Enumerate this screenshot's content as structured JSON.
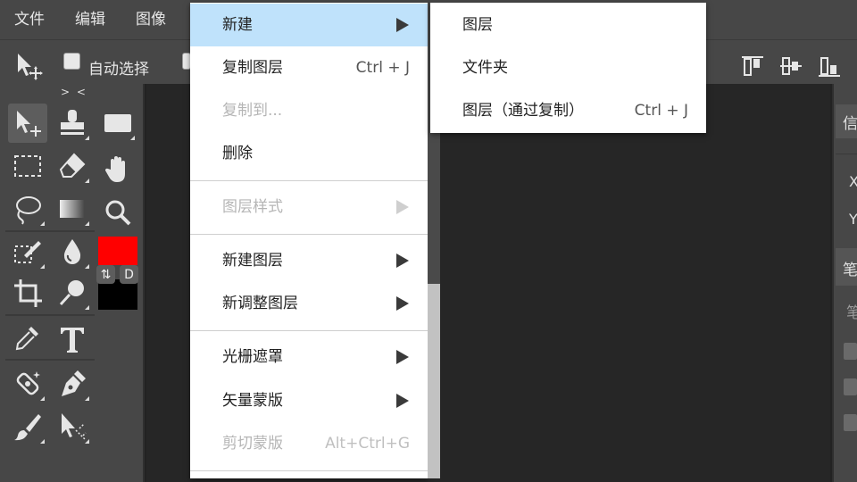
{
  "menubar": {
    "items": [
      {
        "label": "文件"
      },
      {
        "label": "编辑"
      },
      {
        "label": "图像"
      }
    ]
  },
  "options_bar": {
    "auto_select_label": "自动选择",
    "auto_select_checked": false
  },
  "toolbox": {
    "collapse_label": "> <",
    "swap_colors_glyph": "⇅",
    "default_colors_label": "D",
    "foreground_color": "#ff0000",
    "background_color": "#000000"
  },
  "context_menu": {
    "items": [
      {
        "label": "新建",
        "shortcut": "",
        "has_submenu": true,
        "disabled": false,
        "highlighted": true
      },
      {
        "label": "复制图层",
        "shortcut": "Ctrl + J",
        "has_submenu": false,
        "disabled": false
      },
      {
        "label": "复制到...",
        "shortcut": "",
        "has_submenu": false,
        "disabled": true
      },
      {
        "label": "删除",
        "shortcut": "",
        "has_submenu": false,
        "disabled": false
      },
      {
        "label": "图层样式",
        "shortcut": "",
        "has_submenu": true,
        "disabled": true
      },
      {
        "label": "新建图层",
        "shortcut": "",
        "has_submenu": true,
        "disabled": false
      },
      {
        "label": "新调整图层",
        "shortcut": "",
        "has_submenu": true,
        "disabled": false
      },
      {
        "label": "光栅遮罩",
        "shortcut": "",
        "has_submenu": true,
        "disabled": false
      },
      {
        "label": "矢量蒙版",
        "shortcut": "",
        "has_submenu": true,
        "disabled": false
      },
      {
        "label": "剪切蒙版",
        "shortcut": "Alt+Ctrl+G",
        "has_submenu": false,
        "disabled": true
      }
    ]
  },
  "submenu": {
    "items": [
      {
        "label": "图层",
        "shortcut": ""
      },
      {
        "label": "文件夹",
        "shortcut": ""
      },
      {
        "label": "图层（通过复制）",
        "shortcut": "Ctrl + J"
      }
    ]
  },
  "right_panel": {
    "tab1_partial": "信",
    "x_label": "X",
    "y_label": "Y",
    "tab2_partial": "笔",
    "sub_partial": "笔"
  },
  "colors": {
    "highlight": "#bfe2fb",
    "panel_bg": "#474747",
    "canvas_bg": "#262626"
  }
}
